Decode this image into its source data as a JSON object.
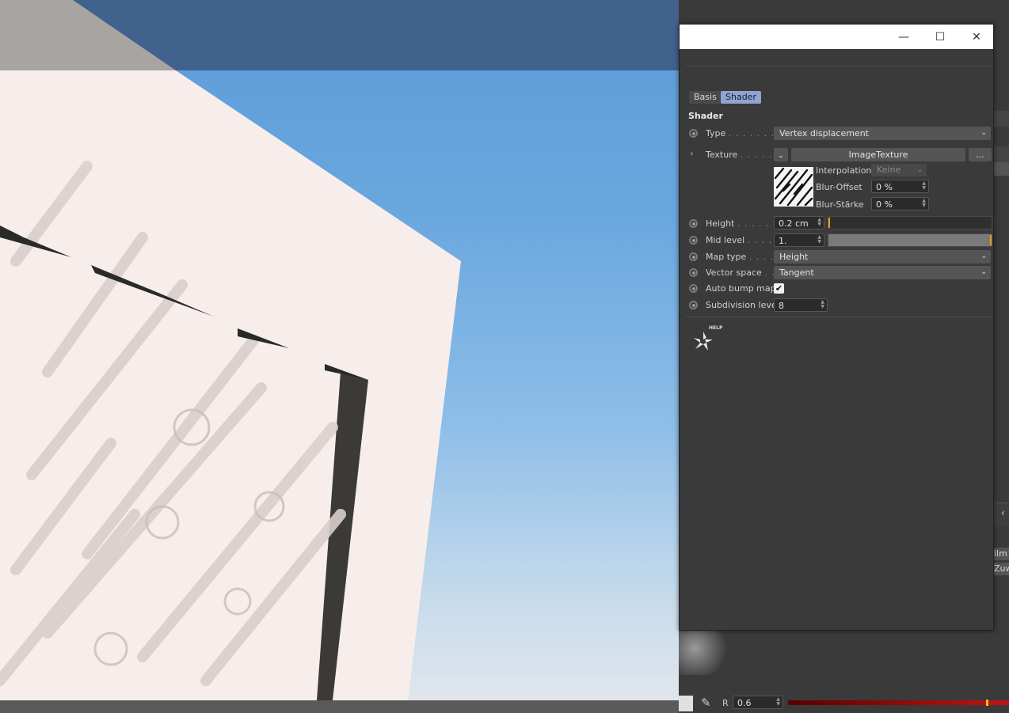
{
  "window": {
    "minimize_glyph": "—",
    "maximize_glyph": "☐",
    "close_glyph": "✕"
  },
  "tabs": [
    {
      "label": "Basis",
      "active": false
    },
    {
      "label": "Shader",
      "active": true
    }
  ],
  "section_title": "Shader",
  "fields": {
    "type": {
      "label": "Type",
      "dots": ". . . . . . . .",
      "value": "Vertex displacement"
    },
    "texture": {
      "label": "Texture",
      "dots": ". . . . . .",
      "value": "ImageTexture",
      "more": "..."
    },
    "interpolation": {
      "label": "Interpolation",
      "value": "Keine"
    },
    "blur_offset": {
      "label": "Blur-Offset",
      "value": "0 %"
    },
    "blur_staerke": {
      "label": "Blur-Stärke",
      "value": "0 %"
    },
    "height": {
      "label": "Height",
      "dots": ". . . . . .",
      "value": "0.2 cm",
      "slider_fraction": 0.0
    },
    "mid_level": {
      "label": "Mid level",
      "dots": ". . . . .",
      "value": "1.",
      "slider_fraction": 1.0
    },
    "map_type": {
      "label": "Map type",
      "dots": ". . . .",
      "value": "Height"
    },
    "vector_space": {
      "label": "Vector space",
      "dots": ". .",
      "value": "Tangent"
    },
    "auto_bump_map": {
      "label": "Auto bump map",
      "checked": true
    },
    "subdivision_level": {
      "label": "Subdivision level",
      "value": "8"
    }
  },
  "help_badge": "HELP",
  "background_app": {
    "film_label": "ilm",
    "zuw_label": "Zuwe",
    "color_channel": "R",
    "color_value": "0.6"
  },
  "colors": {
    "accent": "#f0a020",
    "tab_active": "#8fa4cf",
    "panel": "#3a3a3a",
    "sky_top": "#5b9bd9",
    "red_bar": "#c01414"
  }
}
